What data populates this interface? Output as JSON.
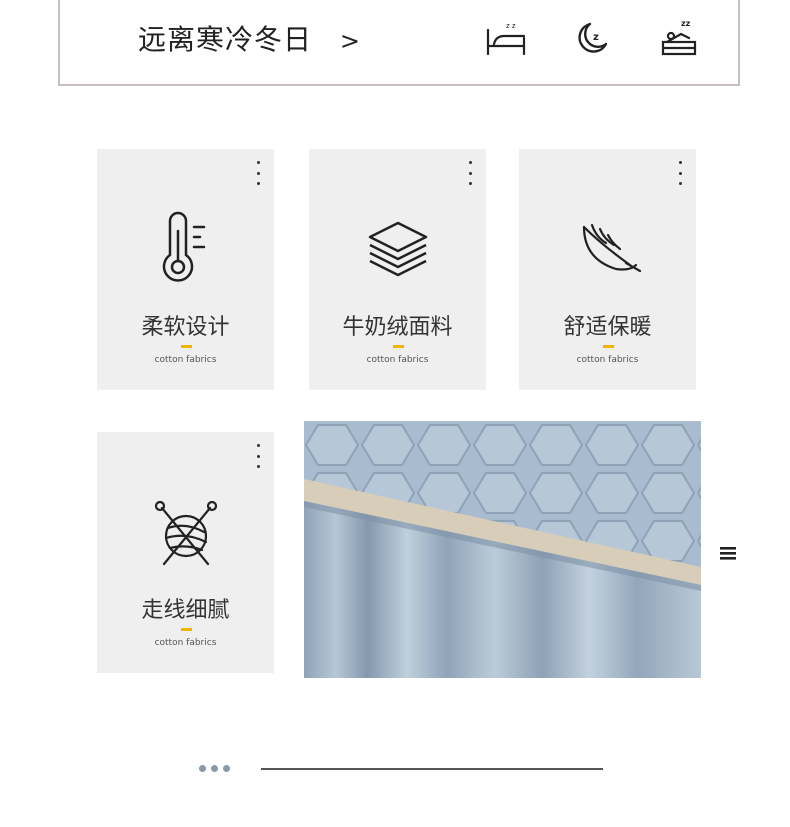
{
  "banner": {
    "title": "远离寒冷冬日",
    "chevron": ">",
    "icons": [
      "sleeping-bed-icon",
      "moon-sleep-icon",
      "sleeping-person-icon"
    ]
  },
  "features": [
    {
      "title": "柔软设计",
      "subtitle": "cotton fabrics",
      "icon": "thermometer-icon"
    },
    {
      "title": "牛奶绒面料",
      "subtitle": "cotton fabrics",
      "icon": "stacked-layers-icon"
    },
    {
      "title": "舒适保暖",
      "subtitle": "cotton fabrics",
      "icon": "feather-icon"
    },
    {
      "title": "走线细腻",
      "subtitle": "cotton fabrics",
      "icon": "yarn-ball-icon"
    }
  ],
  "colors": {
    "accent": "#f0b400",
    "card_bg": "#efefef",
    "banner_border": "#c9bdc5",
    "fabric_blue": "#9fb3c7",
    "pager_dots": "#8a98a8"
  }
}
